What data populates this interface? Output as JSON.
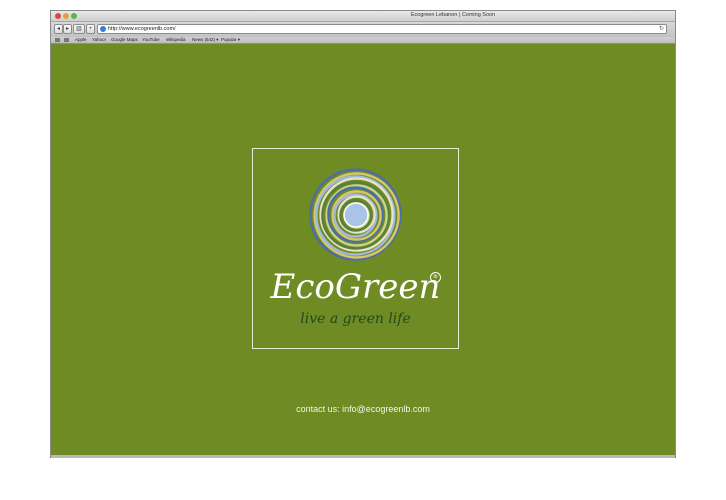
{
  "window": {
    "title": "Ecogreen Lebanon | Coming Soon"
  },
  "toolbar": {
    "back_label": "◂",
    "forward_label": "▸",
    "bookmarks_button_label": "▥",
    "add_label": "+",
    "url": "http://www.ecogreenlb.com/",
    "reload_label": "↻"
  },
  "bookmarks_bar": {
    "items": [
      "Apple",
      "Yahoo!",
      "Google Maps",
      "YouTube",
      "Wikipedia",
      "News (542) ▾",
      "Popular ▾"
    ]
  },
  "page": {
    "brand": "EcoGreen",
    "registered_mark": "lb",
    "tagline": "live a green life",
    "contact": "contact us: info@ecogreenlb.com"
  },
  "colors": {
    "page_background": "#6f8b24",
    "tagline": "#1f4a1f",
    "logo_rings": [
      "#4a6fa8",
      "#d9c66b",
      "#9fb9e0",
      "#e8e2c8",
      "#5a7f3a",
      "#c9d48a"
    ]
  }
}
